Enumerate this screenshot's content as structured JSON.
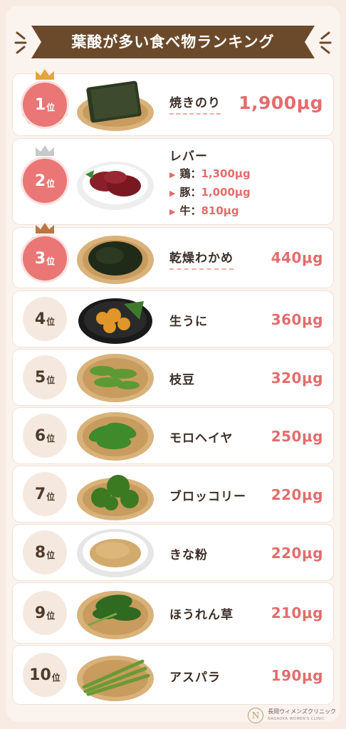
{
  "title": "葉酸が多い食べ物ランキング",
  "rank_suffix": "位",
  "items": [
    {
      "rank": "1",
      "name": "焼きのり",
      "value": "1,900μg"
    },
    {
      "rank": "2",
      "name": "レバー",
      "subs": [
        {
          "label": "鶏：",
          "value": "1,300μg"
        },
        {
          "label": "豚：",
          "value": "1,000μg"
        },
        {
          "label": "牛：",
          "value": "810μg"
        }
      ]
    },
    {
      "rank": "3",
      "name": "乾燥わかめ",
      "value": "440μg"
    },
    {
      "rank": "4",
      "name": "生うに",
      "value": "360μg"
    },
    {
      "rank": "5",
      "name": "枝豆",
      "value": "320μg"
    },
    {
      "rank": "6",
      "name": "モロヘイヤ",
      "value": "250μg"
    },
    {
      "rank": "7",
      "name": "ブロッコリー",
      "value": "220μg"
    },
    {
      "rank": "8",
      "name": "きな粉",
      "value": "220μg"
    },
    {
      "rank": "9",
      "name": "ほうれん草",
      "value": "210μg"
    },
    {
      "rank": "10",
      "name": "アスパラ",
      "value": "190μg"
    }
  ],
  "footer": {
    "logo": "N",
    "name": "長岡ウィメンズクリニック",
    "sub": "NAGAOKA WOMEN'S CLINIC"
  },
  "colors": {
    "accent": "#e36c6c",
    "ribbon": "#6b4a2b",
    "gold": "#e4a63a",
    "silver": "#c9c9c9",
    "bronze": "#b87745"
  }
}
